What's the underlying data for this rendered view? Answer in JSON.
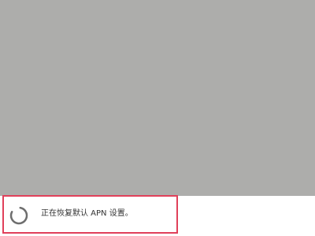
{
  "dialog": {
    "message": "正在恢复默认 APN 设置。",
    "spinner_icon": "loading-spinner-icon"
  },
  "colors": {
    "scrim": "#adadab",
    "highlight": "#e0405a",
    "spinner": "#6e6e6e",
    "text": "#333333"
  }
}
